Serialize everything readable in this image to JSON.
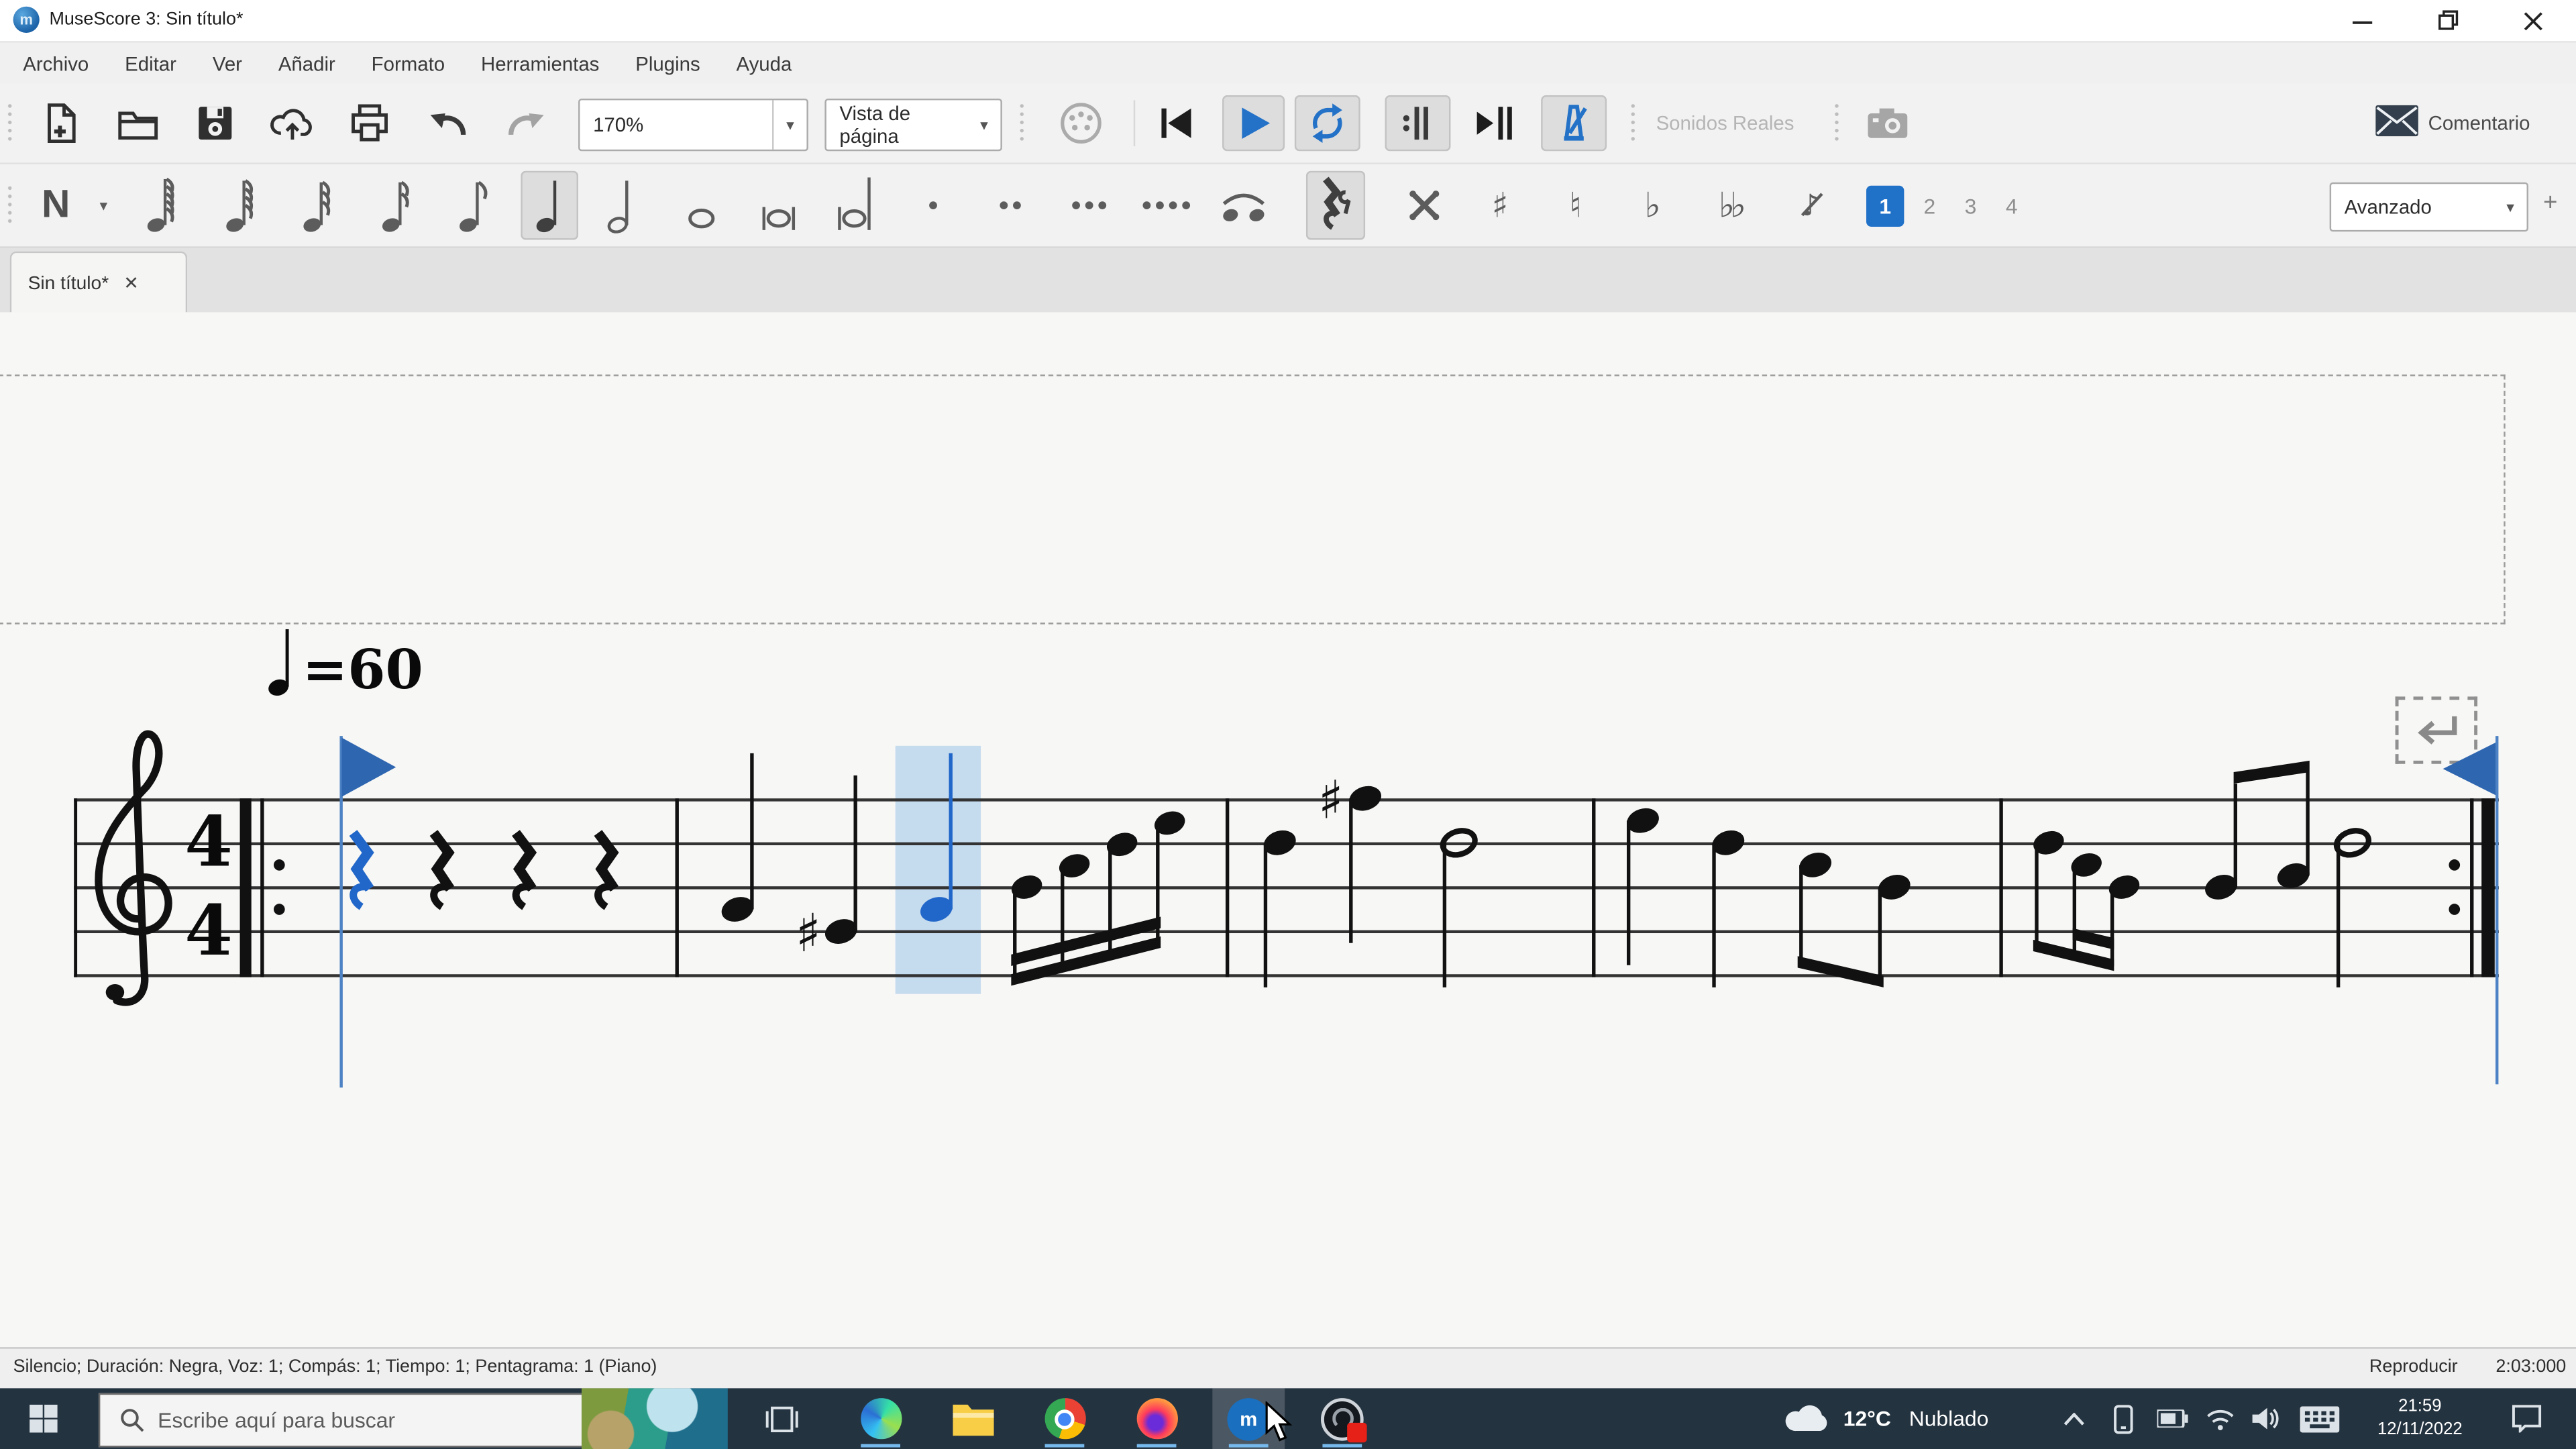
{
  "window": {
    "title": "MuseScore 3: Sin título*",
    "app_name": "MuseScore 3",
    "logo_letter": "m"
  },
  "menu_bar": {
    "items": [
      "Archivo",
      "Editar",
      "Ver",
      "Añadir",
      "Formato",
      "Herramientas",
      "Plugins",
      "Ayuda"
    ]
  },
  "toolbar_main": {
    "zoom_value": "170%",
    "zoom_arrow": "▼",
    "view_mode_value": "Vista de página",
    "view_arrow": "▼",
    "sonidos_reales_label": "Sonidos Reales",
    "comment_label": "Comentario"
  },
  "toolbar_note_input": {
    "note_input_label": "N",
    "note_input_arrow": "▼",
    "accidental_double_sharp": "𝄪",
    "accidental_sharp": "♯",
    "accidental_natural": "♮",
    "accidental_flat": "♭",
    "accidental_double_flat": "♭♭",
    "grace_note_glyph": "♪",
    "voice_labels": [
      "1",
      "2",
      "3",
      "4"
    ],
    "workspace_value": "Avanzado",
    "workspace_arrow": "▼",
    "add_workspace_label": "+"
  },
  "tab_bar": {
    "active_tab": "Sin título*",
    "close_glyph": "✕"
  },
  "score": {
    "tempo_text": "=60",
    "tempo_bpm": 60,
    "time_signature_top": "4",
    "time_signature_bottom": "4",
    "clef": "treble",
    "selected_element": "quarter rest, measure 1 (blue)",
    "measures": [
      "compás 1: 4 silencios de negra (el primero seleccionado en azul, cursor de reproducción con bandera azul)",
      "compás 2: negra A4, negra G#4, negra A4 (resaltada en azul), 4 semicorcheas ascendentes unidas",
      "compás 3: negra D5, negra F#5, blanca D5",
      "compás 4: negra E5, negra D5, dos corcheas unidas C5-B4",
      "compás 5: corchea+2 semicorcheas descendentes, 2 corcheas con barra alta, blanca D5, barra de repetición final"
    ],
    "repeat_start": true,
    "repeat_end": true,
    "line_break_marker": "↵"
  },
  "status_bar": {
    "selection_info": "Silencio; Duración: Negra, Voz: 1; Compás: 1; Tiempo: 1; Pentagrama: 1 (Piano)",
    "play_state_label": "Reproducir",
    "play_time": "2:03:000"
  },
  "taskbar": {
    "search_placeholder": "Escribe aquí para buscar",
    "weather_temp": "12°C",
    "weather_desc": "Nublado",
    "clock_time": "21:59",
    "clock_date": "12/11/2022",
    "musescore_letter": "m"
  },
  "icons": {
    "minimize": "—",
    "restore": "❐",
    "close": "✕",
    "search": "magnifier",
    "new-score": "document-plus",
    "open": "folder",
    "save": "floppy",
    "cloud-save": "cloud-up-arrow",
    "print": "printer",
    "undo": "curved-arrow-left",
    "redo": "curved-arrow-right",
    "midi-input": "din-connector",
    "rewind": "|◀",
    "play": "▶",
    "loop": "circular-arrows",
    "play-repeats": ":||",
    "pan-playback": "▶||",
    "metronome": "metronome",
    "image-capture": "camera",
    "feedback": "envelope"
  },
  "colors": {
    "selection_blue": "#2167c9",
    "playback_cursor_blue": "#4d82c4",
    "playback_flag_blue": "#2e66b0",
    "highlight_band": "#bcd6ec",
    "voice1_blue": "#2071c8",
    "toolbar_icon_blue": "#2372c8",
    "taskbar_bg": "#243340",
    "page_bg": "#f7f7f5"
  }
}
